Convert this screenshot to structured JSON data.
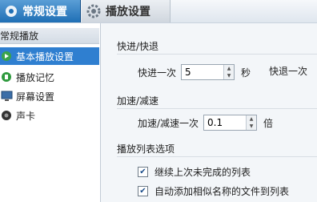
{
  "tabs": [
    {
      "label": "常规设置",
      "icon": "settings-icon"
    },
    {
      "label": "播放设置",
      "icon": "gear-icon"
    }
  ],
  "sidebar": {
    "header": "常规播放",
    "items": [
      {
        "label": "基本播放设置",
        "icon": "play-icon",
        "selected": true
      },
      {
        "label": "播放记忆",
        "icon": "record-icon",
        "selected": false
      },
      {
        "label": "屏幕设置",
        "icon": "monitor-icon",
        "selected": false
      },
      {
        "label": "声卡",
        "icon": "speaker-icon",
        "selected": false
      }
    ]
  },
  "content": {
    "fast_seek": {
      "title": "快进/快退",
      "forward_label": "快进一次",
      "forward_value": "5",
      "forward_unit": "秒",
      "backward_label": "快退一次"
    },
    "speed": {
      "title": "加速/减速",
      "label": "加速/减速一次",
      "value": "0.1",
      "unit": "倍"
    },
    "playlist": {
      "title": "播放列表选项",
      "options": [
        {
          "label": "继续上次未完成的列表",
          "checked": true
        },
        {
          "label": "自动添加相似名称的文件到列表",
          "checked": true
        }
      ]
    }
  },
  "colors": {
    "accent": "#2f7fd0",
    "tab_active": "#1f6fb5"
  }
}
